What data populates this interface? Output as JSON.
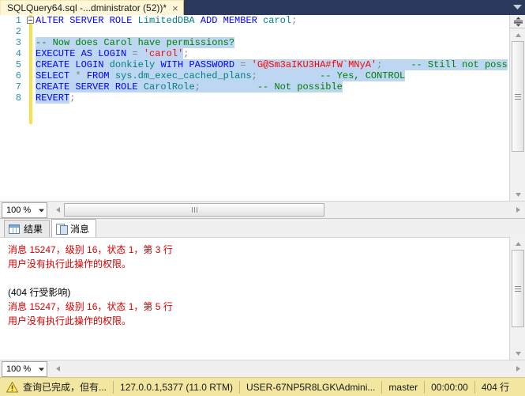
{
  "window": {
    "tab_title": "SQLQuery64.sql -...dministrator (52))*",
    "close_label": "×",
    "chevron_icon": "chevron-down-icon"
  },
  "editor": {
    "lines": [
      {
        "number": "1",
        "fold": true,
        "tokens": [
          {
            "t": "ALTER SERVER ROLE ",
            "c": "kw",
            "sel": false
          },
          {
            "t": "LimitedDBA ",
            "c": "sys",
            "sel": false
          },
          {
            "t": "ADD MEMBER ",
            "c": "kw",
            "sel": false
          },
          {
            "t": "carol",
            "c": "sys",
            "sel": false
          },
          {
            "t": ";",
            "c": "op",
            "sel": false
          }
        ]
      },
      {
        "number": "2",
        "fold": false,
        "tokens": []
      },
      {
        "number": "3",
        "fold": false,
        "tokens": [
          {
            "t": "-- Now does Carol have permissions?",
            "c": "cmt",
            "sel": true
          }
        ]
      },
      {
        "number": "4",
        "fold": false,
        "tokens": [
          {
            "t": "EXECUTE AS LOGIN ",
            "c": "kw",
            "sel": true
          },
          {
            "t": "= ",
            "c": "op",
            "sel": true
          },
          {
            "t": "'carol'",
            "c": "str",
            "sel": true
          },
          {
            "t": ";",
            "c": "op",
            "sel": false
          }
        ]
      },
      {
        "number": "5",
        "fold": false,
        "tokens": [
          {
            "t": "CREATE LOGIN ",
            "c": "kw",
            "sel": true
          },
          {
            "t": "donkiely ",
            "c": "sys",
            "sel": true
          },
          {
            "t": "WITH PASSWORD ",
            "c": "kw",
            "sel": true
          },
          {
            "t": "= ",
            "c": "op",
            "sel": true
          },
          {
            "t": "'G@Sm3aIKU3HA#fW`MNyA'",
            "c": "str",
            "sel": true
          },
          {
            "t": ";",
            "c": "op",
            "sel": true
          },
          {
            "t": "     ",
            "c": "pl",
            "sel": true
          },
          {
            "t": "-- Still not poss",
            "c": "cmt",
            "sel": true
          }
        ]
      },
      {
        "number": "6",
        "fold": false,
        "tokens": [
          {
            "t": "SELECT ",
            "c": "kw",
            "sel": true
          },
          {
            "t": "* ",
            "c": "op",
            "sel": true
          },
          {
            "t": "FROM ",
            "c": "kw",
            "sel": true
          },
          {
            "t": "sys.dm_exec_cached_plans",
            "c": "sys",
            "sel": true
          },
          {
            "t": ";",
            "c": "op",
            "sel": true
          },
          {
            "t": "           ",
            "c": "pl",
            "sel": true
          },
          {
            "t": "-- Yes, CONTROL",
            "c": "cmt",
            "sel": true
          }
        ]
      },
      {
        "number": "7",
        "fold": false,
        "tokens": [
          {
            "t": "CREATE SERVER ROLE ",
            "c": "kw",
            "sel": true
          },
          {
            "t": "CarolRole",
            "c": "sys",
            "sel": true
          },
          {
            "t": ";",
            "c": "op",
            "sel": true
          },
          {
            "t": "          ",
            "c": "pl",
            "sel": true
          },
          {
            "t": "-- Not possible",
            "c": "cmt",
            "sel": true
          }
        ]
      },
      {
        "number": "8",
        "fold": false,
        "tokens": [
          {
            "t": "REVERT",
            "c": "kw",
            "sel": true
          },
          {
            "t": ";",
            "c": "op",
            "sel": false
          }
        ]
      }
    ]
  },
  "editor_zoombar": {
    "zoom": "100 %",
    "dropdown_icon": "chevron-down-icon",
    "left_arrow_icon": "arrow-left-icon",
    "right_arrow_icon": "arrow-right-icon"
  },
  "results_zoombar": {
    "zoom": "100 %",
    "dropdown_icon": "chevron-down-icon",
    "left_arrow_icon": "arrow-left-icon",
    "right_arrow_icon": "arrow-right-icon"
  },
  "results_tabs": [
    {
      "label": "结果",
      "icon": "grid-icon",
      "active": false
    },
    {
      "label": "消息",
      "icon": "message-icon",
      "active": true
    }
  ],
  "messages": [
    {
      "text": "消息 15247，级别 16，状态 1，第 3 行",
      "type": "err"
    },
    {
      "text": "用户没有执行此操作的权限。",
      "type": "err"
    },
    {
      "text": "",
      "type": "blank"
    },
    {
      "text": "(404 行受影响)",
      "type": "info"
    },
    {
      "text": "消息 15247，级别 16，状态 1，第 5 行",
      "type": "err"
    },
    {
      "text": "用户没有执行此操作的权限。",
      "type": "err"
    }
  ],
  "statusbar": {
    "warning_icon": "warning-icon",
    "status_text": "查询已完成，但有...",
    "server": "127.0.0.1,5377 (11.0 RTM)",
    "user": "USER-67NP5R8LGK\\Admini...",
    "database": "master",
    "elapsed": "00:00:00",
    "rows": "404 行"
  },
  "colors": {
    "titlebar": "#2b3a5c",
    "tab_bg": "#fdf6d8",
    "selection": "#bdd6f2",
    "keyword": "#0000ff",
    "comment": "#008000",
    "string": "#ff0000",
    "system_object": "#008080",
    "error_text": "#d40000",
    "statusbar_bg": "#f2e6a0",
    "change_bar": "#fbe04d",
    "line_number": "#2b91af"
  }
}
